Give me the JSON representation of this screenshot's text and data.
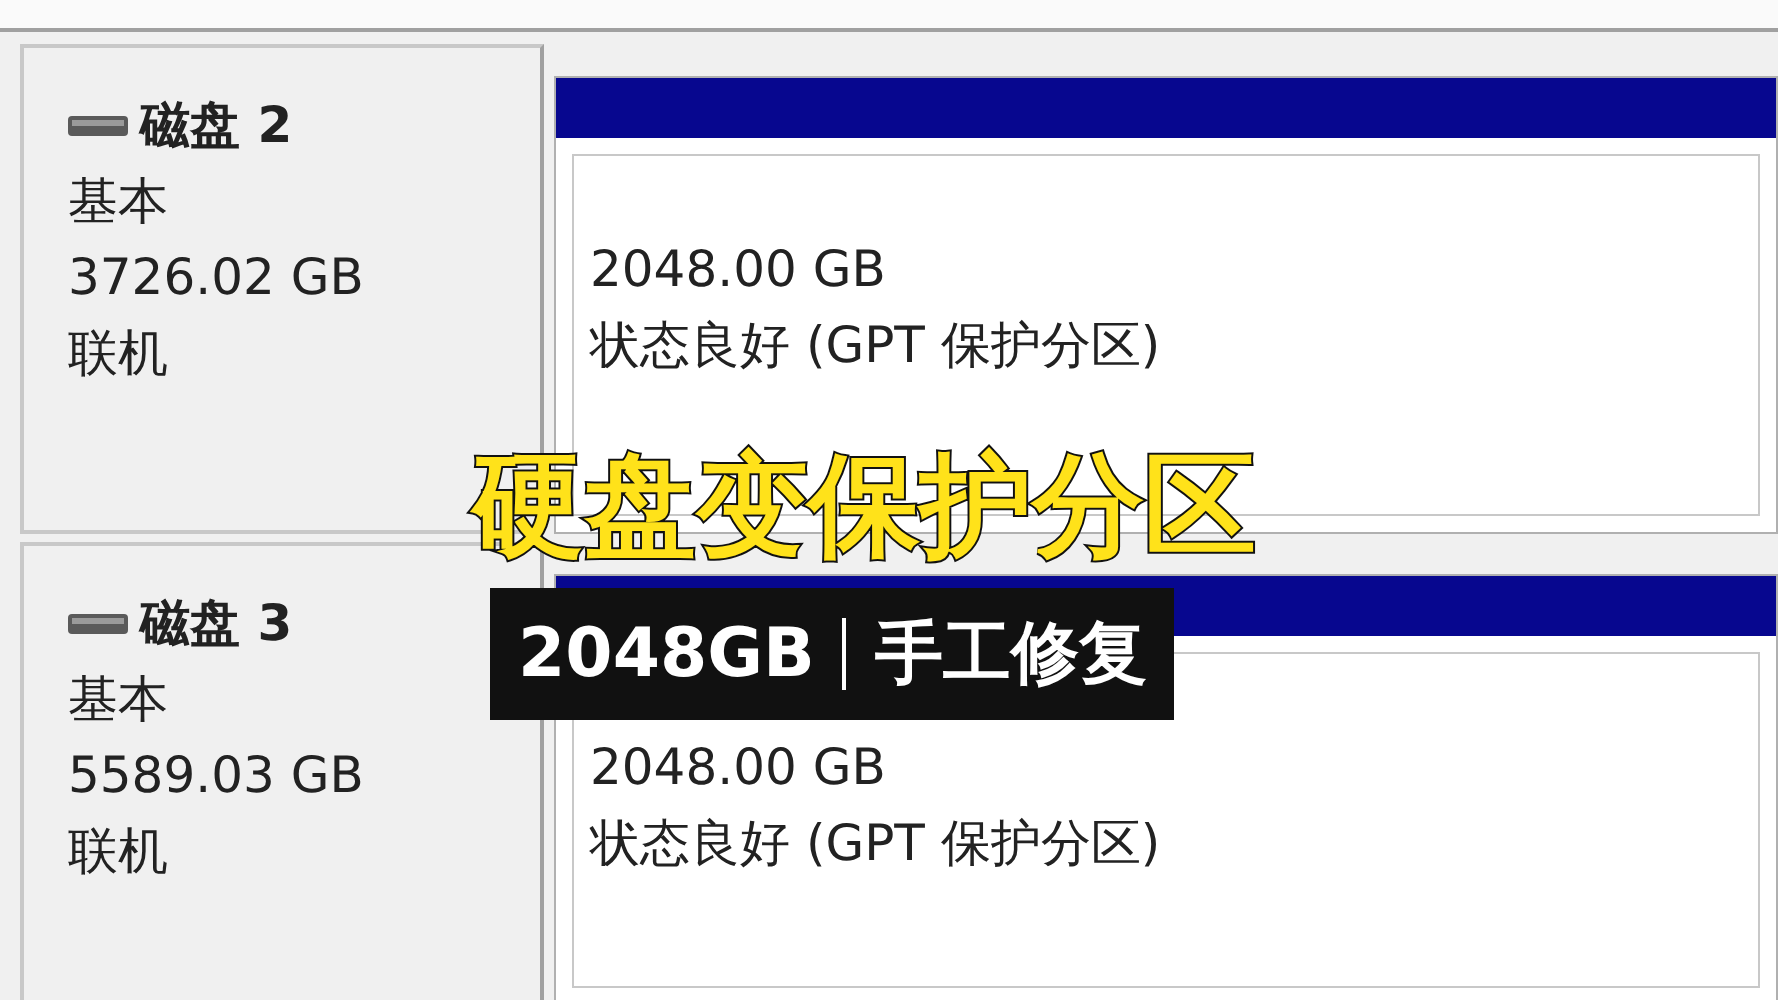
{
  "disks": [
    {
      "name": "磁盘 2",
      "type": "基本",
      "size": "3726.02 GB",
      "status": "联机",
      "partitions": [
        {
          "size": "2048.00 GB",
          "status": "状态良好 (GPT 保护分区)"
        }
      ]
    },
    {
      "name": "磁盘 3",
      "type": "基本",
      "size": "5589.03 GB",
      "status": "联机",
      "partitions": [
        {
          "size": "2048.00 GB",
          "status": "状态良好 (GPT 保护分区)"
        }
      ]
    }
  ],
  "overlay": {
    "headline": "硬盘变保护分区",
    "caption_parts": [
      "2048GB",
      "手工修复"
    ]
  }
}
